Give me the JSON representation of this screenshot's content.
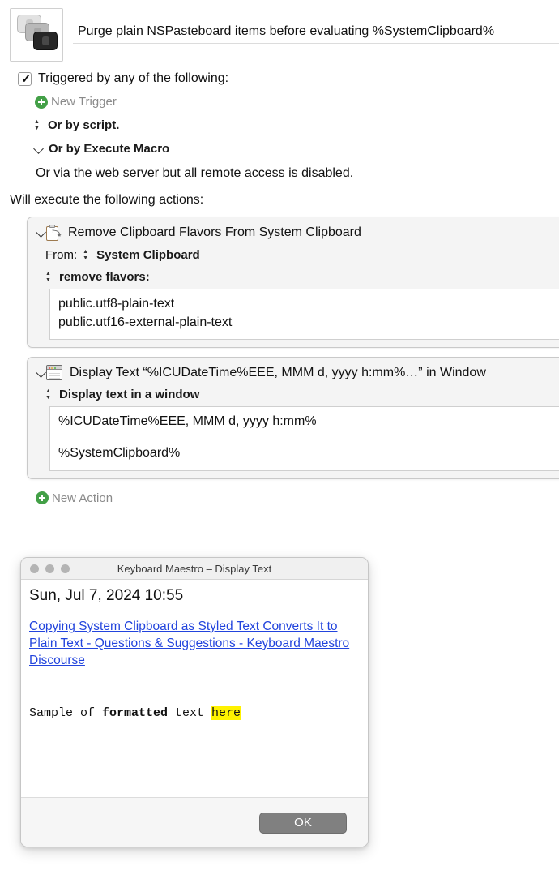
{
  "macro": {
    "icon_name": "pasteboard-stack-icon",
    "title": "Purge plain NSPasteboard items before evaluating %SystemClipboard%"
  },
  "triggers": {
    "checkbox_checked": true,
    "checkbox_glyph": "✓",
    "label": "Triggered by any of the following:",
    "new_trigger_label": "New Trigger",
    "or_script_label": "Or by script.",
    "or_execute_macro_label": "Or by Execute Macro",
    "web_server_note": "Or via the web server but all remote access is disabled."
  },
  "actions_header": "Will execute the following actions:",
  "actions": [
    {
      "icon_name": "clipboard-icon",
      "title": "Remove Clipboard Flavors From System Clipboard",
      "from_label": "From:",
      "source_popup": "System Clipboard",
      "flavors_popup": "remove flavors:",
      "flavors": [
        "public.utf8-plain-text",
        "public.utf16-external-plain-text"
      ]
    },
    {
      "icon_name": "window-icon",
      "title": "Display Text “%ICUDateTime%EEE, MMM d, yyyy h:mm%…” in Window",
      "display_popup": "Display text in a window",
      "text_lines": [
        "%ICUDateTime%EEE, MMM d, yyyy h:mm%",
        "",
        "%SystemClipboard%"
      ]
    }
  ],
  "new_action_label": "New Action",
  "dialog": {
    "title": "Keyboard Maestro – Display Text",
    "date_line": "Sun, Jul 7, 2024 10:55",
    "link_text": "Copying System Clipboard as Styled Text Converts It to Plain Text - Questions & Suggestions - Keyboard Maestro Discourse",
    "sample": {
      "before": "Sample of ",
      "bold": "formatted",
      "middle": " text ",
      "highlight": "here"
    },
    "ok_label": "OK"
  },
  "colors": {
    "accent_green": "#43a047",
    "link_blue": "#2244dd",
    "highlight_yellow": "#fff200",
    "button_gray": "#808080"
  }
}
